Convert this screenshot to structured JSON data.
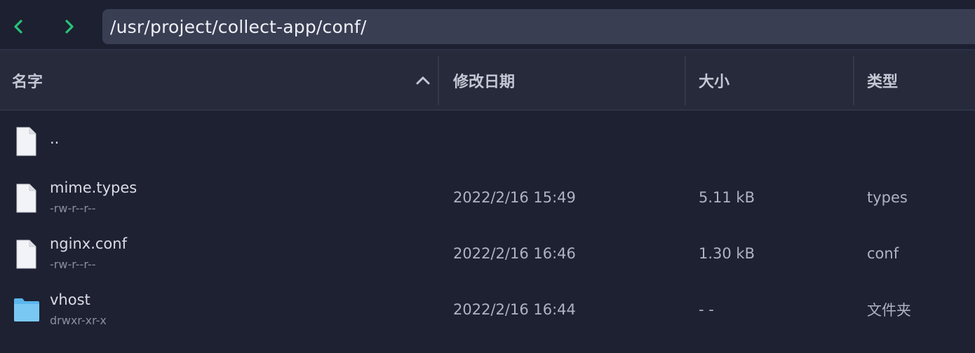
{
  "toolbar": {
    "path": "/usr/project/collect-app/conf/",
    "accent": "#27c37a"
  },
  "columns": {
    "name": "名字",
    "modified": "修改日期",
    "size": "大小",
    "type": "类型"
  },
  "files": [
    {
      "name": "..",
      "perm": "",
      "modified": "",
      "size": "",
      "type": "",
      "icon": "file-icon"
    },
    {
      "name": "mime.types",
      "perm": "-rw-r--r--",
      "modified": "2022/2/16 15:49",
      "size": "5.11 kB",
      "type": "types",
      "icon": "file-icon"
    },
    {
      "name": "nginx.conf",
      "perm": "-rw-r--r--",
      "modified": "2022/2/16 16:46",
      "size": "1.30 kB",
      "type": "conf",
      "icon": "file-icon"
    },
    {
      "name": "vhost",
      "perm": "drwxr-xr-x",
      "modified": "2022/2/16 16:44",
      "size": "- -",
      "type": "文件夹",
      "icon": "folder-icon"
    }
  ]
}
